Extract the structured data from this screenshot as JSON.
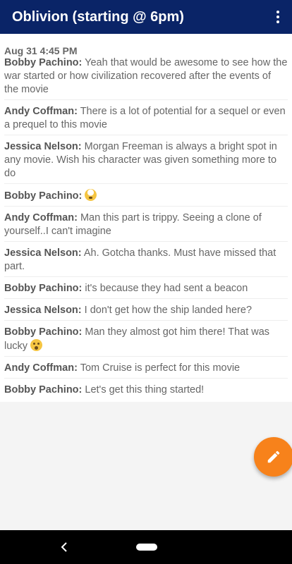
{
  "header": {
    "title": "Oblivion (starting @ 6pm)",
    "menu_icon": "more-vert-icon"
  },
  "chat": {
    "date": "Aug 31 4:45 PM",
    "messages": [
      {
        "sender": "Bobby Pachino:",
        "text": " Yeah that would be awesome to see how the war started or how civilization recovered after the events of the movie"
      },
      {
        "sender": "Andy Coffman:",
        "text": " There is a lot of potential for a sequel or even a prequel to this movie"
      },
      {
        "sender": "Jessica Nelson:",
        "text": " Morgan Freeman is always a bright spot in any movie. Wish his character was given something more to do"
      },
      {
        "sender": "Bobby Pachino:",
        "text": " ",
        "emoji": "exploding-head-emoji"
      },
      {
        "sender": "Andy Coffman:",
        "text": " Man this part is trippy. Seeing a clone of yourself..I can't imagine"
      },
      {
        "sender": "Jessica Nelson:",
        "text": " Ah. Gotcha thanks. Must have missed that part."
      },
      {
        "sender": "Bobby Pachino:",
        "text": " it's because they had sent a beacon"
      },
      {
        "sender": "Jessica Nelson:",
        "text": " I don't get how the ship landed here?"
      },
      {
        "sender": "Bobby Pachino:",
        "text": " Man they almost got him there! That was lucky ",
        "emoji": "worried-face-emoji"
      },
      {
        "sender": "Andy Coffman:",
        "text": " Tom Cruise is perfect for this movie"
      },
      {
        "sender": "Bobby Pachino:",
        "text": " Let's get this thing started!"
      }
    ]
  },
  "fab": {
    "icon": "pencil-icon"
  },
  "navbar": {
    "back_icon": "back-icon",
    "home_icon": "home-pill-icon"
  },
  "colors": {
    "appbar": "#0a2467",
    "fab": "#f7821b",
    "text": "#666666"
  }
}
